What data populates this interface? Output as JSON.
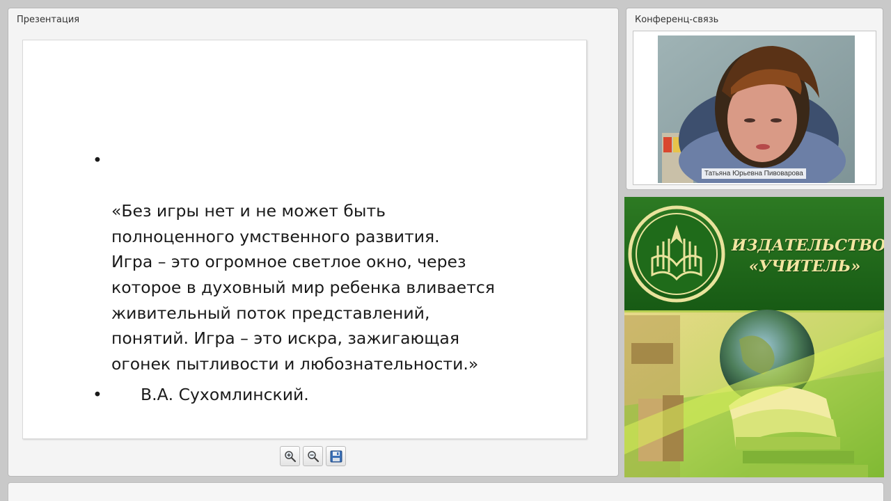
{
  "presentation": {
    "title": "Презентация",
    "slide": {
      "quote": "«Без игры нет и не может быть\nполноценного умственного развития.\nИгра – это огромное светлое окно, через\nкоторое в духовный мир ребенка вливается\nживительный поток представлений,\nпонятий. Игра – это искра, зажигающая\nогонек пытливости и любознательности.»",
      "author": "В.А. Сухомлинский.",
      "bullet": "•"
    },
    "toolbar": {
      "zoom_in_icon": "zoom-in-icon",
      "zoom_out_icon": "zoom-out-icon",
      "save_icon": "floppy-disk-icon"
    }
  },
  "conference": {
    "title": "Конференц-связь",
    "participant_name": "Татьяна Юрьевна Пивоварова"
  },
  "banner": {
    "publisher_line1": "ИЗДАТЕЛЬСТВО",
    "publisher_line2": "«УЧИТЕЛЬ»",
    "colors": {
      "banner_green": "#1f6b1a",
      "text_gold": "#f3e6a2",
      "light_green": "#b5d84a"
    }
  }
}
